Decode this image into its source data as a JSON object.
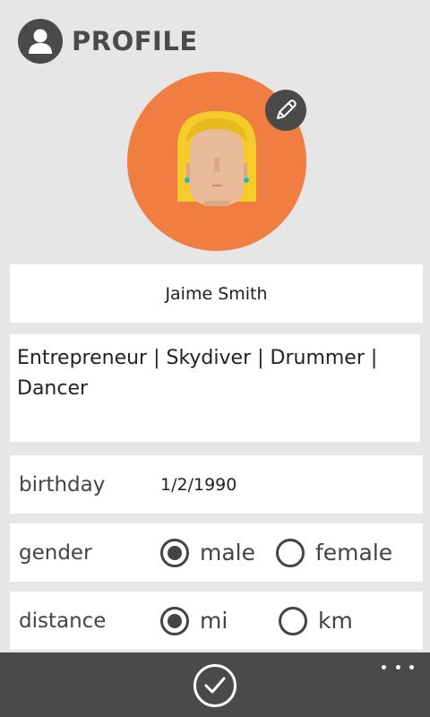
{
  "header": {
    "title": "PROFILE",
    "icon": "user-icon"
  },
  "avatar": {
    "background_color": "#f07d42",
    "edit_icon": "pencil-icon"
  },
  "profile": {
    "name": "Jaime Smith",
    "bio": "Entrepreneur | Skydiver | Drummer | Dancer"
  },
  "fields": {
    "birthday": {
      "label": "birthday",
      "value": "1/2/1990"
    },
    "gender": {
      "label": "gender",
      "options": [
        {
          "label": "male",
          "selected": true
        },
        {
          "label": "female",
          "selected": false
        }
      ]
    },
    "distance": {
      "label": "distance",
      "options": [
        {
          "label": "mi",
          "selected": true
        },
        {
          "label": "km",
          "selected": false
        }
      ]
    }
  },
  "appbar": {
    "primary_icon": "checkmark-icon",
    "more_icon": "more-icon",
    "background_color": "#4a4a4a"
  }
}
